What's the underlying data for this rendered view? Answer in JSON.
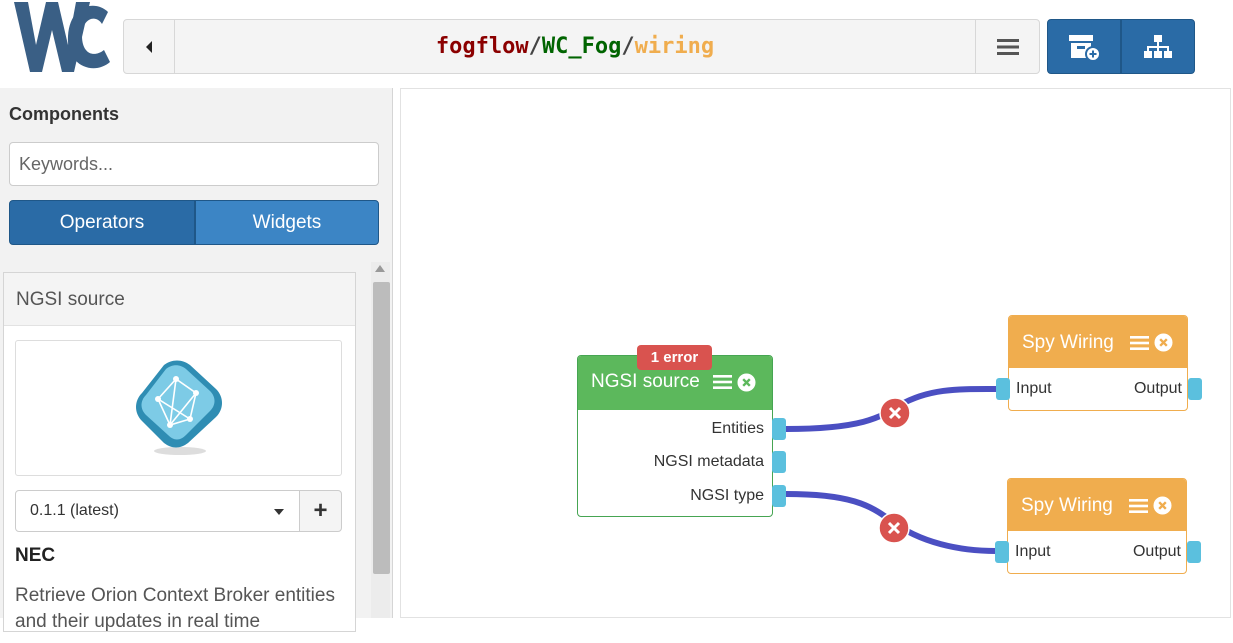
{
  "header": {
    "logo_text": "Wirecloud",
    "path": {
      "owner": "fogflow",
      "sep1": "/",
      "workspace": "WC_Fog",
      "sep2": "/",
      "view": "wiring"
    },
    "colors": {
      "owner": "#8b0000",
      "workspace": "#006400",
      "view": "#f0ad4e",
      "sep": "#444444"
    },
    "icons": [
      "back-icon",
      "menu-icon",
      "add-component-icon",
      "sitemap-icon"
    ]
  },
  "sidebar": {
    "title": "Components",
    "search_placeholder": "Keywords...",
    "tabs": {
      "operators": "Operators",
      "widgets": "Widgets"
    },
    "card": {
      "title": "NGSI source",
      "version": "0.1.1 (latest)",
      "add_label": "+",
      "vendor": "NEC",
      "description": "Retrieve Orion Context Broker entities and their updates in real time"
    }
  },
  "canvas": {
    "operator": {
      "title": "NGSI source",
      "error_badge": "1 error",
      "endpoints": [
        "Entities",
        "NGSI metadata",
        "NGSI type"
      ]
    },
    "spy_top": {
      "title": "Spy Wiring",
      "input": "Input",
      "output": "Output"
    },
    "spy_bottom": {
      "title": "Spy Wiring",
      "input": "Input",
      "output": "Output"
    },
    "colors": {
      "operator": "#5cb85c",
      "widget": "#f0ad4e",
      "connection": "#4b4fc2",
      "error": "#d9534f",
      "endpoint": "#5bc0de"
    }
  }
}
